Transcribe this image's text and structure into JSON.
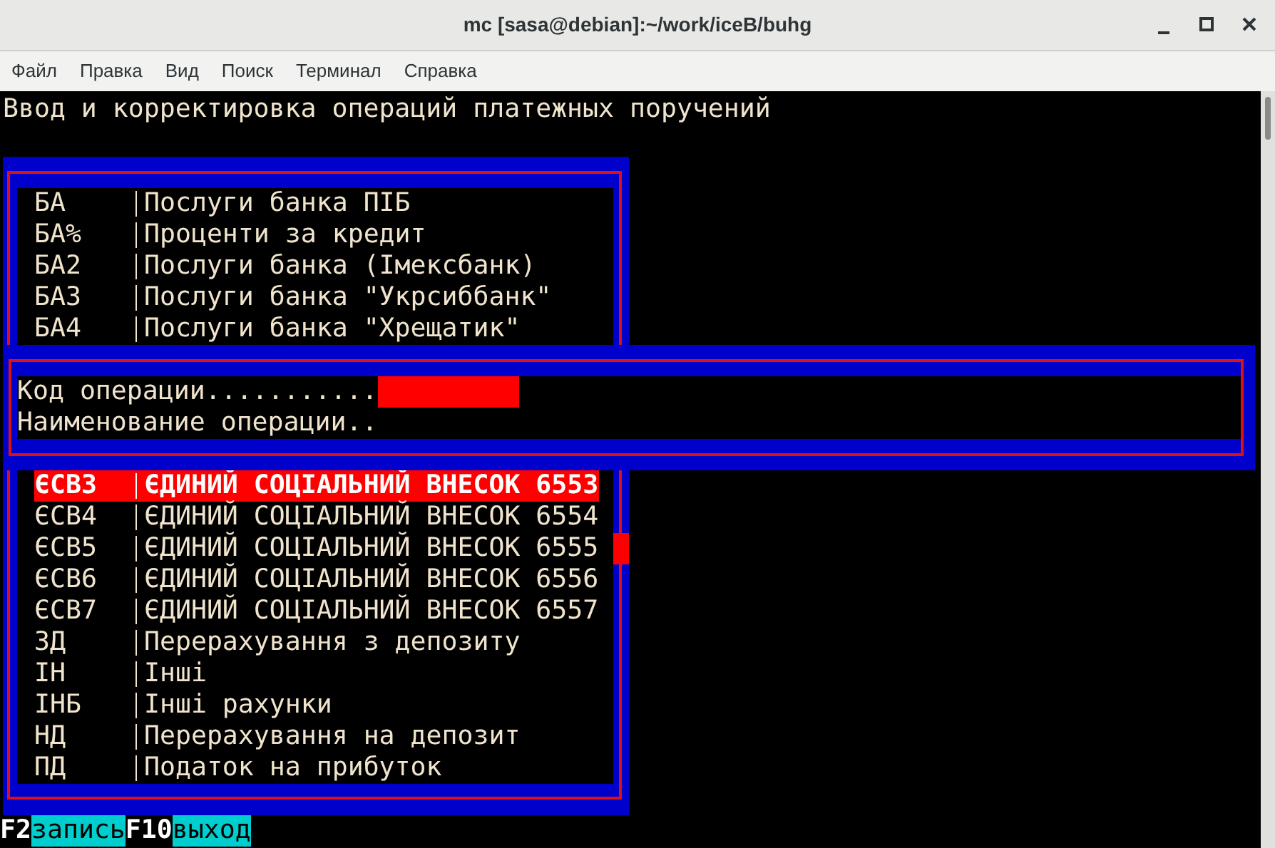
{
  "window": {
    "title": "mc [sasa@debian]:~/work/iceB/buhg"
  },
  "menu": [
    "Файл",
    "Правка",
    "Вид",
    "Поиск",
    "Терминал",
    "Справка"
  ],
  "screen_title": "Ввод и корректировка операций платежных поручений",
  "list": {
    "top_items": [
      {
        "code": "БА",
        "name": "Послуги банка ПІБ",
        "selected": false
      },
      {
        "code": "БА%",
        "name": "Проценти за кредит",
        "selected": false
      },
      {
        "code": "БА2",
        "name": "Послуги банка (Імексбанк)",
        "selected": false
      },
      {
        "code": "БА3",
        "name": "Послуги банка \"Укрсиббанк\"",
        "selected": false
      },
      {
        "code": "БА4",
        "name": "Послуги банка \"Хрещатик\"",
        "selected": false
      }
    ],
    "bottom_items": [
      {
        "code": "ЄСВ3",
        "name": "ЄДИНИЙ СОЦІАЛЬНИЙ ВНЕСОК 6553",
        "selected": true
      },
      {
        "code": "ЄСВ4",
        "name": "ЄДИНИЙ СОЦІАЛЬНИЙ ВНЕСОК 6554",
        "selected": false
      },
      {
        "code": "ЄСВ5",
        "name": "ЄДИНИЙ СОЦІАЛЬНИЙ ВНЕСОК 6555",
        "selected": false
      },
      {
        "code": "ЄСВ6",
        "name": "ЄДИНИЙ СОЦІАЛЬНИЙ ВНЕСОК 6556",
        "selected": false
      },
      {
        "code": "ЄСВ7",
        "name": "ЄДИНИЙ СОЦІАЛЬНИЙ ВНЕСОК 6557",
        "selected": false
      },
      {
        "code": "ЗД",
        "name": "Перерахування з депозиту",
        "selected": false
      },
      {
        "code": "ІН",
        "name": "Інші",
        "selected": false
      },
      {
        "code": "ІНБ",
        "name": "Інші рахунки",
        "selected": false
      },
      {
        "code": "НД",
        "name": "Перерахування на депозит",
        "selected": false
      },
      {
        "code": "ПД",
        "name": "Податок на прибуток",
        "selected": false
      }
    ]
  },
  "dialog": {
    "fields": [
      {
        "label": "Код операции...........",
        "kind": "input"
      },
      {
        "label": "Наименование операции..",
        "kind": "text"
      }
    ]
  },
  "function_keys": [
    {
      "key": "F2",
      "label": "запись"
    },
    {
      "key": "F10",
      "label": "выход"
    }
  ]
}
